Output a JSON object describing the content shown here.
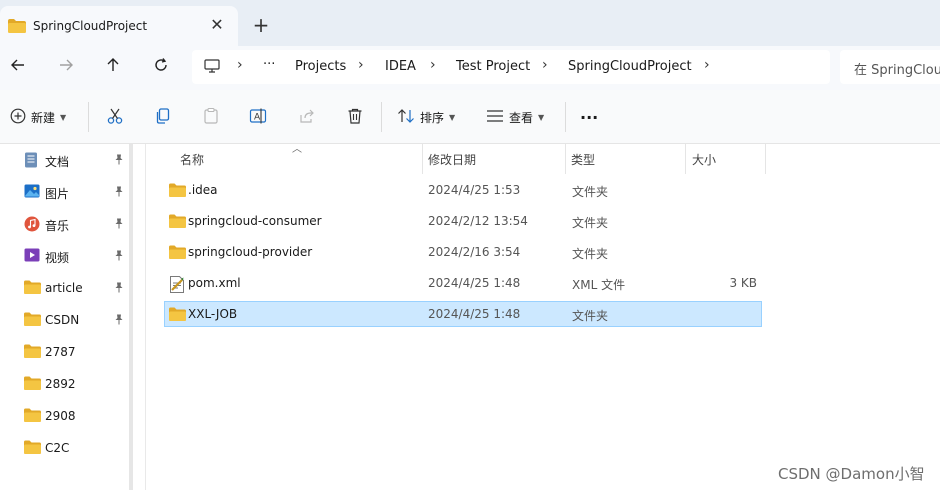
{
  "tab": {
    "title": "SpringCloudProject",
    "close_icon": "close-icon",
    "new_tab_icon": "plus-icon"
  },
  "nav": {
    "back_icon": "arrow-left-icon",
    "forward_icon": "arrow-right-icon",
    "up_icon": "arrow-up-icon",
    "refresh_icon": "refresh-icon"
  },
  "address": {
    "overflow": "···",
    "crumbs": [
      "Projects",
      "IDEA",
      "Test Project",
      "SpringCloudProject"
    ],
    "separator": "›"
  },
  "search": {
    "placeholder": "在 SpringCloudProject 中搜索",
    "visible_text": "在 SpringClou"
  },
  "toolbar": {
    "new_label": "新建",
    "sort_label": "排序",
    "view_label": "查看",
    "more_label": "···"
  },
  "sidebar": {
    "items": [
      {
        "label": "文档",
        "icon": "documents-icon",
        "pinned": true
      },
      {
        "label": "图片",
        "icon": "pictures-icon",
        "pinned": true
      },
      {
        "label": "音乐",
        "icon": "music-icon",
        "pinned": true
      },
      {
        "label": "视频",
        "icon": "videos-icon",
        "pinned": true
      },
      {
        "label": "article",
        "icon": "folder-icon",
        "pinned": true
      },
      {
        "label": "CSDN",
        "icon": "folder-icon",
        "pinned": true
      },
      {
        "label": "2787",
        "icon": "folder-icon",
        "pinned": false
      },
      {
        "label": "2892",
        "icon": "folder-icon",
        "pinned": false
      },
      {
        "label": "2908",
        "icon": "folder-icon",
        "pinned": false
      },
      {
        "label": "C2C",
        "icon": "folder-icon",
        "pinned": false
      }
    ]
  },
  "columns": {
    "name": "名称",
    "date": "修改日期",
    "type": "类型",
    "size": "大小"
  },
  "files": [
    {
      "name": ".idea",
      "date": "2024/4/25 1:53",
      "type": "文件夹",
      "size": "",
      "icon": "folder-icon",
      "selected": false
    },
    {
      "name": "springcloud-consumer",
      "date": "2024/2/12 13:54",
      "type": "文件夹",
      "size": "",
      "icon": "folder-icon",
      "selected": false
    },
    {
      "name": "springcloud-provider",
      "date": "2024/2/16 3:54",
      "type": "文件夹",
      "size": "",
      "icon": "folder-icon",
      "selected": false
    },
    {
      "name": "pom.xml",
      "date": "2024/4/25 1:48",
      "type": "XML 文件",
      "size": "3 KB",
      "icon": "xml-file-icon",
      "selected": false
    },
    {
      "name": "XXL-JOB",
      "date": "2024/4/25 1:48",
      "type": "文件夹",
      "size": "",
      "icon": "folder-icon",
      "selected": true
    }
  ],
  "watermark": "CSDN @Damon小智",
  "colors": {
    "folder": "#f4c542",
    "folder_dark": "#e2a928",
    "selection_bg": "#cce8ff",
    "selection_border": "#99d1ff",
    "accent": "#0067c0"
  }
}
